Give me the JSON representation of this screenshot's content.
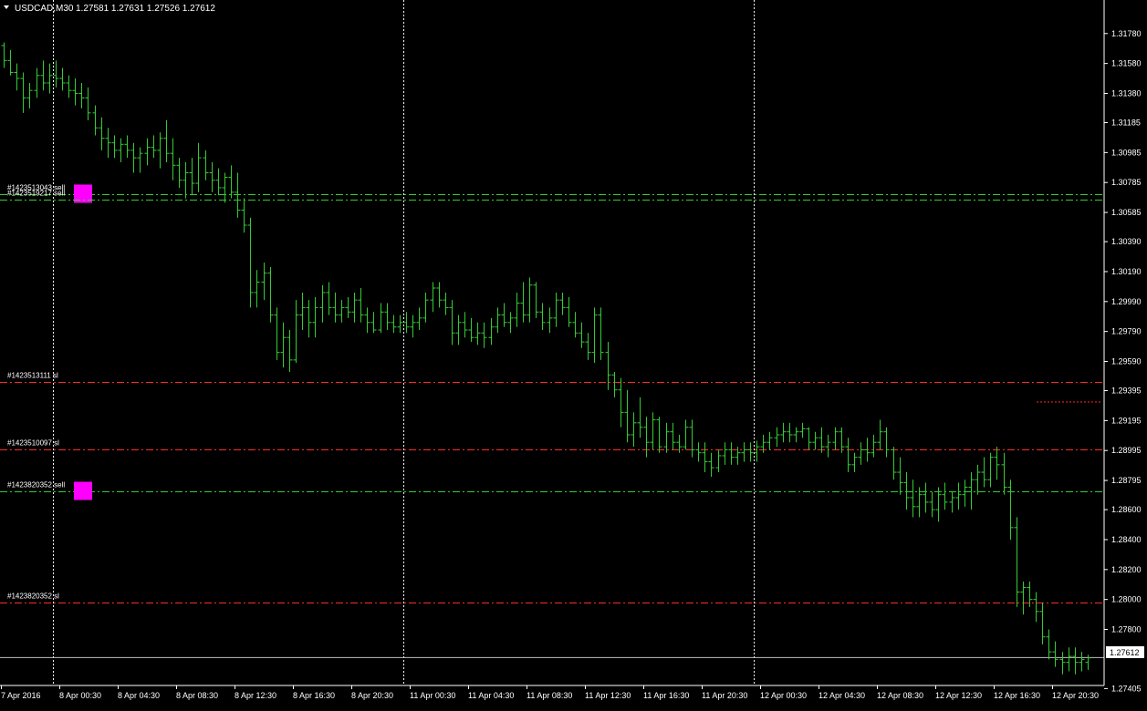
{
  "header": {
    "symbol_timeframe": "USDCAD,M30",
    "ohlc": "1.27581 1.27631 1.27526 1.27612"
  },
  "colors": {
    "background": "#000000",
    "candle": "#33cc33",
    "grid": "#ffffff",
    "axis": "#ffffff",
    "sell_line": "#33cc33",
    "sl_line": "#ff2a2a",
    "order_marker": "#ff00ff",
    "bid_line": "#c0c0c0"
  },
  "chart_data": {
    "type": "ohlc",
    "title": "USDCAD,M30",
    "ylim": [
      1.2745,
      1.3187
    ],
    "price_ticks": [
      "1.31780",
      "1.31580",
      "1.31380",
      "1.31185",
      "1.30985",
      "1.30785",
      "1.30585",
      "1.30390",
      "1.30190",
      "1.29990",
      "1.29790",
      "1.29590",
      "1.29395",
      "1.29195",
      "1.28995",
      "1.28795",
      "1.28600",
      "1.28400",
      "1.28200",
      "1.28000",
      "1.27800",
      "1.27405"
    ],
    "time_labels": [
      "7 Apr 2016",
      "8 Apr 00:30",
      "8 Apr 04:30",
      "8 Apr 08:30",
      "8 Apr 12:30",
      "8 Apr 16:30",
      "8 Apr 20:30",
      "11 Apr 00:30",
      "11 Apr 04:30",
      "11 Apr 08:30",
      "11 Apr 12:30",
      "11 Apr 16:30",
      "11 Apr 20:30",
      "12 Apr 00:30",
      "12 Apr 04:30",
      "12 Apr 08:30",
      "12 Apr 12:30",
      "12 Apr 16:30",
      "12 Apr 20:30"
    ],
    "day_separators": [
      "8 Apr 00:00",
      "11 Apr 00:00",
      "12 Apr 00:00"
    ],
    "current_price": "1.27612",
    "grid": false,
    "order_lines": [
      {
        "label": "#1423513043 sell",
        "price": 1.3071,
        "kind": "sell",
        "marker": true
      },
      {
        "label": "#1423519217 sell",
        "price": 1.3067,
        "kind": "sell",
        "marker": false
      },
      {
        "label": "#1423513111 sl",
        "price": 1.2945,
        "kind": "sl",
        "marker": false
      },
      {
        "label": "#1423510097 sl",
        "price": 1.29,
        "kind": "sl",
        "marker": false
      },
      {
        "label": "#1423820352 sell",
        "price": 1.2872,
        "kind": "sell",
        "marker": true
      },
      {
        "label": "#1423820352 sl",
        "price": 1.2798,
        "kind": "sl",
        "marker": false
      }
    ],
    "ohlc": [
      [
        1.317,
        1.3172,
        1.3155,
        1.316
      ],
      [
        1.316,
        1.3167,
        1.315,
        1.3152
      ],
      [
        1.3152,
        1.3158,
        1.314,
        1.3148
      ],
      [
        1.3148,
        1.3152,
        1.3125,
        1.3135
      ],
      [
        1.3135,
        1.3145,
        1.3128,
        1.314
      ],
      [
        1.314,
        1.3155,
        1.3135,
        1.315
      ],
      [
        1.315,
        1.316,
        1.314,
        1.3145
      ],
      [
        1.3145,
        1.3158,
        1.3138,
        1.315
      ],
      [
        1.315,
        1.316,
        1.3142,
        1.3148
      ],
      [
        1.3148,
        1.3155,
        1.314,
        1.3145
      ],
      [
        1.3145,
        1.315,
        1.3135,
        1.314
      ],
      [
        1.314,
        1.3148,
        1.313,
        1.3138
      ],
      [
        1.3138,
        1.3145,
        1.3128,
        1.3135
      ],
      [
        1.3135,
        1.3142,
        1.312,
        1.3125
      ],
      [
        1.3125,
        1.313,
        1.311,
        1.3115
      ],
      [
        1.3115,
        1.3122,
        1.31,
        1.3108
      ],
      [
        1.3108,
        1.3115,
        1.3095,
        1.3105
      ],
      [
        1.3105,
        1.311,
        1.3095,
        1.31
      ],
      [
        1.31,
        1.3108,
        1.3092,
        1.3104
      ],
      [
        1.3104,
        1.311,
        1.3095,
        1.31
      ],
      [
        1.31,
        1.3105,
        1.3085,
        1.3095
      ],
      [
        1.3095,
        1.3102,
        1.3085,
        1.3098
      ],
      [
        1.3098,
        1.3108,
        1.309,
        1.3102
      ],
      [
        1.3102,
        1.311,
        1.3095,
        1.31
      ],
      [
        1.31,
        1.3112,
        1.3088,
        1.3108
      ],
      [
        1.3108,
        1.312,
        1.3092,
        1.3098
      ],
      [
        1.3098,
        1.3108,
        1.308,
        1.309
      ],
      [
        1.309,
        1.3095,
        1.3075,
        1.308
      ],
      [
        1.308,
        1.3092,
        1.3068,
        1.3085
      ],
      [
        1.3085,
        1.3095,
        1.307,
        1.3078
      ],
      [
        1.3078,
        1.3105,
        1.3072,
        1.3095
      ],
      [
        1.3095,
        1.31,
        1.308,
        1.3085
      ],
      [
        1.3085,
        1.3092,
        1.3072,
        1.308
      ],
      [
        1.308,
        1.3088,
        1.307,
        1.3075
      ],
      [
        1.3075,
        1.3085,
        1.3065,
        1.3082
      ],
      [
        1.3082,
        1.309,
        1.3068,
        1.3072
      ],
      [
        1.3072,
        1.3085,
        1.3055,
        1.306
      ],
      [
        1.306,
        1.3068,
        1.3045,
        1.305
      ],
      [
        1.305,
        1.3055,
        1.2995,
        1.3005
      ],
      [
        1.3005,
        1.302,
        1.2995,
        1.3012
      ],
      [
        1.3012,
        1.3025,
        1.3,
        1.3018
      ],
      [
        1.3018,
        1.3022,
        1.2985,
        1.299
      ],
      [
        1.299,
        1.2995,
        1.296,
        1.2965
      ],
      [
        1.2965,
        1.2985,
        1.2955,
        1.2975
      ],
      [
        1.2975,
        1.298,
        1.2952,
        1.296
      ],
      [
        1.296,
        1.3,
        1.2958,
        1.299
      ],
      [
        1.299,
        1.3005,
        1.298,
        1.2995
      ],
      [
        1.2995,
        1.3,
        1.2975,
        1.2985
      ],
      [
        1.2985,
        1.3002,
        1.2975,
        1.2995
      ],
      [
        1.2995,
        1.301,
        1.2985,
        1.3005
      ],
      [
        1.3005,
        1.3012,
        1.299,
        1.2995
      ],
      [
        1.2995,
        1.3005,
        1.2985,
        1.299
      ],
      [
        1.299,
        1.3,
        1.2985,
        1.2995
      ],
      [
        1.2995,
        1.3002,
        1.2988,
        1.2992
      ],
      [
        1.2992,
        1.3005,
        1.2985,
        1.3
      ],
      [
        1.3,
        1.3008,
        1.2985,
        1.299
      ],
      [
        1.299,
        1.2995,
        1.2978,
        1.2985
      ],
      [
        1.2985,
        1.2992,
        1.2978,
        1.298
      ],
      [
        1.298,
        1.2998,
        1.2978,
        1.2992
      ],
      [
        1.2992,
        1.2998,
        1.298,
        1.2985
      ],
      [
        1.2985,
        1.299,
        1.2978,
        1.2982
      ],
      [
        1.2982,
        1.299,
        1.2978,
        1.2985
      ],
      [
        1.2985,
        1.2992,
        1.2978,
        1.2982
      ],
      [
        1.2982,
        1.299,
        1.2975,
        1.2985
      ],
      [
        1.2985,
        1.2995,
        1.298,
        1.2988
      ],
      [
        1.2988,
        1.3005,
        1.2985,
        1.3
      ],
      [
        1.3,
        1.3012,
        1.2992,
        1.3008
      ],
      [
        1.3008,
        1.3012,
        1.2995,
        1.3
      ],
      [
        1.3,
        1.3005,
        1.299,
        1.2995
      ],
      [
        1.2995,
        1.3,
        1.297,
        1.2978
      ],
      [
        1.2978,
        1.299,
        1.297,
        1.2985
      ],
      [
        1.2985,
        1.2992,
        1.2975,
        1.298
      ],
      [
        1.298,
        1.2988,
        1.2972,
        1.2975
      ],
      [
        1.2975,
        1.2985,
        1.297,
        1.2978
      ],
      [
        1.2978,
        1.2985,
        1.2968,
        1.2975
      ],
      [
        1.2975,
        1.2988,
        1.297,
        1.2982
      ],
      [
        1.2982,
        1.2995,
        1.2978,
        1.299
      ],
      [
        1.299,
        1.2998,
        1.2982,
        1.2985
      ],
      [
        1.2985,
        1.2992,
        1.2978,
        1.2988
      ],
      [
        1.2988,
        1.3005,
        1.2982,
        1.2998
      ],
      [
        1.2998,
        1.3012,
        1.2985,
        1.299
      ],
      [
        1.299,
        1.3015,
        1.2985,
        1.301
      ],
      [
        1.301,
        1.3012,
        1.2988,
        1.2992
      ],
      [
        1.2992,
        1.2998,
        1.298,
        1.2985
      ],
      [
        1.2985,
        1.2995,
        1.2978,
        1.2988
      ],
      [
        1.2988,
        1.3005,
        1.2982,
        1.3
      ],
      [
        1.3,
        1.3005,
        1.299,
        1.2995
      ],
      [
        1.2995,
        1.3002,
        1.2982,
        1.2985
      ],
      [
        1.2985,
        1.2992,
        1.2975,
        1.2978
      ],
      [
        1.2978,
        1.2985,
        1.2968,
        1.2972
      ],
      [
        1.2972,
        1.2978,
        1.296,
        1.2965
      ],
      [
        1.2965,
        1.2995,
        1.2958,
        1.299
      ],
      [
        1.299,
        1.2995,
        1.296,
        1.2965
      ],
      [
        1.2965,
        1.2972,
        1.294,
        1.295
      ],
      [
        1.295,
        1.2952,
        1.2935,
        1.294
      ],
      [
        1.294,
        1.2948,
        1.2915,
        1.2925
      ],
      [
        1.2925,
        1.294,
        1.2905,
        1.291
      ],
      [
        1.291,
        1.2925,
        1.2902,
        1.2918
      ],
      [
        1.2918,
        1.2935,
        1.2908,
        1.2915
      ],
      [
        1.2915,
        1.2922,
        1.2895,
        1.2905
      ],
      [
        1.2905,
        1.2925,
        1.29,
        1.292
      ],
      [
        1.292,
        1.2922,
        1.2898,
        1.2902
      ],
      [
        1.2902,
        1.2918,
        1.2898,
        1.2912
      ],
      [
        1.2912,
        1.2918,
        1.29,
        1.2905
      ],
      [
        1.2905,
        1.291,
        1.2898,
        1.2902
      ],
      [
        1.2902,
        1.292,
        1.29,
        1.2915
      ],
      [
        1.2915,
        1.292,
        1.2895,
        1.29
      ],
      [
        1.29,
        1.2905,
        1.2892,
        1.2898
      ],
      [
        1.2898,
        1.2905,
        1.2885,
        1.2892
      ],
      [
        1.2892,
        1.2898,
        1.2882,
        1.2888
      ],
      [
        1.2888,
        1.29,
        1.2885,
        1.2896
      ],
      [
        1.2896,
        1.2905,
        1.289,
        1.29
      ],
      [
        1.29,
        1.2905,
        1.289,
        1.2895
      ],
      [
        1.2895,
        1.2902,
        1.289,
        1.2898
      ],
      [
        1.2898,
        1.2905,
        1.2892,
        1.29
      ],
      [
        1.29,
        1.2905,
        1.2892,
        1.2898
      ],
      [
        1.2898,
        1.2906,
        1.2892,
        1.2902
      ],
      [
        1.2902,
        1.291,
        1.2898,
        1.2905
      ],
      [
        1.2905,
        1.2912,
        1.29,
        1.2908
      ],
      [
        1.2908,
        1.2915,
        1.2902,
        1.291
      ],
      [
        1.291,
        1.2918,
        1.2905,
        1.2912
      ],
      [
        1.2912,
        1.2918,
        1.2905,
        1.291
      ],
      [
        1.291,
        1.2915,
        1.2905,
        1.2912
      ],
      [
        1.2912,
        1.2918,
        1.2908,
        1.2914
      ],
      [
        1.2914,
        1.2915,
        1.29,
        1.2905
      ],
      [
        1.2905,
        1.2912,
        1.29,
        1.2908
      ],
      [
        1.2908,
        1.2915,
        1.2898,
        1.2902
      ],
      [
        1.2902,
        1.291,
        1.2895,
        1.2905
      ],
      [
        1.2905,
        1.2915,
        1.29,
        1.2912
      ],
      [
        1.2912,
        1.2915,
        1.2898,
        1.2902
      ],
      [
        1.2902,
        1.2908,
        1.2885,
        1.289
      ],
      [
        1.289,
        1.2898,
        1.2885,
        1.2895
      ],
      [
        1.2895,
        1.2905,
        1.289,
        1.29
      ],
      [
        1.29,
        1.2908,
        1.2892,
        1.2898
      ],
      [
        1.2898,
        1.291,
        1.2895,
        1.2905
      ],
      [
        1.2905,
        1.292,
        1.29,
        1.2912
      ],
      [
        1.2912,
        1.2915,
        1.2895,
        1.29
      ],
      [
        1.29,
        1.2902,
        1.288,
        1.2885
      ],
      [
        1.2885,
        1.2895,
        1.287,
        1.2878
      ],
      [
        1.2878,
        1.2885,
        1.286,
        1.2868
      ],
      [
        1.2868,
        1.288,
        1.2855,
        1.2862
      ],
      [
        1.2862,
        1.2875,
        1.2855,
        1.287
      ],
      [
        1.287,
        1.2878,
        1.2858,
        1.2865
      ],
      [
        1.2865,
        1.2872,
        1.2855,
        1.286
      ],
      [
        1.286,
        1.2875,
        1.2852,
        1.287
      ],
      [
        1.287,
        1.2878,
        1.286,
        1.2865
      ],
      [
        1.2865,
        1.2872,
        1.2858,
        1.2868
      ],
      [
        1.2868,
        1.2878,
        1.286,
        1.287
      ],
      [
        1.287,
        1.288,
        1.2862,
        1.2875
      ],
      [
        1.2875,
        1.2885,
        1.286,
        1.288
      ],
      [
        1.288,
        1.289,
        1.287,
        1.2885
      ],
      [
        1.2885,
        1.2895,
        1.2875,
        1.288
      ],
      [
        1.288,
        1.2898,
        1.2875,
        1.2895
      ],
      [
        1.2895,
        1.2902,
        1.288,
        1.289
      ],
      [
        1.289,
        1.2898,
        1.287,
        1.2875
      ],
      [
        1.2875,
        1.288,
        1.284,
        1.2848
      ],
      [
        1.2848,
        1.2855,
        1.2795,
        1.2805
      ],
      [
        1.2805,
        1.2812,
        1.279,
        1.2808
      ],
      [
        1.2808,
        1.2812,
        1.2795,
        1.28
      ],
      [
        1.28,
        1.2805,
        1.2785,
        1.2792
      ],
      [
        1.2792,
        1.2798,
        1.277,
        1.2775
      ],
      [
        1.2775,
        1.278,
        1.276,
        1.2765
      ],
      [
        1.2765,
        1.2772,
        1.2755,
        1.276
      ],
      [
        1.276,
        1.2765,
        1.275,
        1.2758
      ],
      [
        1.2758,
        1.2768,
        1.2752,
        1.2762
      ],
      [
        1.2762,
        1.2768,
        1.275,
        1.2758
      ],
      [
        1.2758,
        1.2765,
        1.2752,
        1.276
      ],
      [
        1.2758,
        1.2763,
        1.2753,
        1.2761
      ]
    ]
  }
}
